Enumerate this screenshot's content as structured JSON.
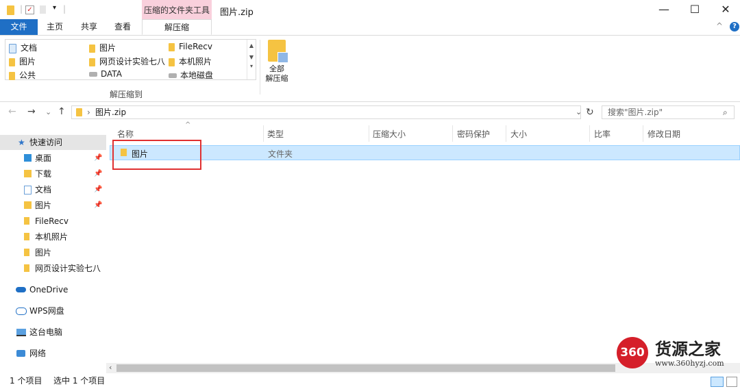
{
  "titlebar": {
    "context_tab": "压缩的文件夹工具",
    "window_title": "图片.zip",
    "minimize": "—",
    "maximize": "☐",
    "close": "✕"
  },
  "ribbon": {
    "tabs": [
      {
        "label": "文件"
      },
      {
        "label": "主页"
      },
      {
        "label": "共享"
      },
      {
        "label": "查看"
      },
      {
        "label": "解压缩"
      }
    ],
    "destinations": [
      "文档",
      "图片",
      "FileRecv",
      "图片",
      "网页设计实验七八",
      "本机照片",
      "公共",
      "DATA",
      "本地磁盘"
    ],
    "extract_all_line1": "全部",
    "extract_all_line2": "解压缩",
    "group_label": "解压缩到",
    "help": "?",
    "collapse": "^"
  },
  "navigation": {
    "back": "←",
    "forward": "→",
    "recent": "⌄",
    "up": "↑",
    "path": "图片.zip",
    "refresh": "↻",
    "search_placeholder": "搜索\"图片.zip\""
  },
  "sidebar": {
    "items": [
      {
        "label": "快速访问",
        "icon": "star-icon",
        "pinned": false
      },
      {
        "label": "桌面",
        "icon": "desktop-folder-icon",
        "pinned": true
      },
      {
        "label": "下载",
        "icon": "download-folder-icon",
        "pinned": true
      },
      {
        "label": "文档",
        "icon": "documents-folder-icon",
        "pinned": true
      },
      {
        "label": "图片",
        "icon": "pictures-folder-icon",
        "pinned": true
      },
      {
        "label": "FileRecv",
        "icon": "folder-icon",
        "pinned": false
      },
      {
        "label": "本机照片",
        "icon": "folder-icon",
        "pinned": false
      },
      {
        "label": "图片",
        "icon": "folder-icon",
        "pinned": false
      },
      {
        "label": "网页设计实验七八",
        "icon": "folder-icon",
        "pinned": false
      },
      {
        "label": "OneDrive",
        "icon": "cloud-icon",
        "pinned": false
      },
      {
        "label": "WPS网盘",
        "icon": "wps-cloud-icon",
        "pinned": false
      },
      {
        "label": "这台电脑",
        "icon": "computer-icon",
        "pinned": false
      },
      {
        "label": "网络",
        "icon": "network-icon",
        "pinned": false
      }
    ]
  },
  "file_list": {
    "columns": [
      "名称",
      "类型",
      "压缩大小",
      "密码保护",
      "大小",
      "比率",
      "修改日期"
    ],
    "rows": [
      {
        "name": "图片",
        "type": "文件夹"
      }
    ]
  },
  "statusbar": {
    "count": "1 个项目",
    "selected": "选中 1 个项目"
  },
  "watermark": {
    "badge": "360",
    "name": "货源之家",
    "url": "www.360hyzj.com"
  },
  "colors": {
    "file_tab": "#1f6fc5",
    "context_tab": "#f9d0dc",
    "selection": "#cce8ff",
    "annotation": "#e03030"
  }
}
